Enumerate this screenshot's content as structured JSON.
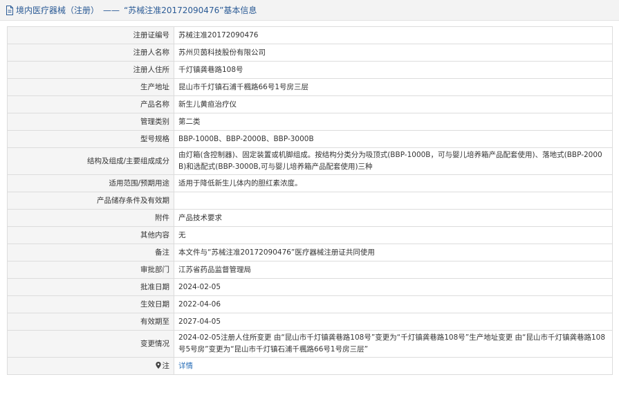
{
  "header": {
    "crumb": "境内医疗器械（注册）",
    "separator": "——",
    "record_title": "“苏械注准20172090476”基本信息"
  },
  "rows": [
    {
      "label": "注册证编号",
      "value": "苏械注准20172090476"
    },
    {
      "label": "注册人名称",
      "value": "苏州贝茵科技股份有限公司"
    },
    {
      "label": "注册人住所",
      "value": "千灯镇龚巷路108号"
    },
    {
      "label": "生产地址",
      "value": "昆山市千灯镇石浦千楓路66号1号房三层"
    },
    {
      "label": "产品名称",
      "value": "新生儿黄疸治疗仪"
    },
    {
      "label": "管理类别",
      "value": "第二类"
    },
    {
      "label": "型号规格",
      "value": "BBP-1000B、BBP-2000B、BBP-3000B"
    },
    {
      "label": "结构及组成/主要组成成分",
      "value": "由灯箱(含控制器)、固定装置或机脚组成。按结构分类分为吸顶式(BBP-1000B，可与婴儿培养箱产品配套使用)、落地式(BBP-2000B)和选配式(BBP-3000B,可与婴儿培养箱产品配套使用)三种"
    },
    {
      "label": "适用范围/预期用途",
      "value": "适用于降低新生儿体内的胆红素浓度。"
    },
    {
      "label": "产品储存条件及有效期",
      "value": ""
    },
    {
      "label": "附件",
      "value": "产品技术要求"
    },
    {
      "label": "其他内容",
      "value": "无"
    },
    {
      "label": "备注",
      "value": "本文件与“苏械注准20172090476”医疗器械注册证共同使用"
    },
    {
      "label": "审批部门",
      "value": "江苏省药品监督管理局"
    },
    {
      "label": "批准日期",
      "value": "2024-02-05"
    },
    {
      "label": "生效日期",
      "value": "2022-04-06"
    },
    {
      "label": "有效期至",
      "value": "2027-04-05"
    },
    {
      "label": "变更情况",
      "value": "2024-02-05注册人住所变更 由“昆山市千灯镇龚巷路108号”变更为“千灯镇龚巷路108号”生产地址变更 由“昆山市千灯镇龚巷路108号5号房”变更为“昆山市千灯镇石浦千楓路66号1号房三层”"
    }
  ],
  "note_row": {
    "label": "注",
    "link_text": "详情"
  },
  "colors": {
    "title_text": "#2a5a95",
    "label_bg": "#f5f5f5",
    "border": "#dcdcdc",
    "link": "#2a6fb8"
  },
  "icons": {
    "title": "document-icon",
    "note": "map-pin-icon"
  }
}
